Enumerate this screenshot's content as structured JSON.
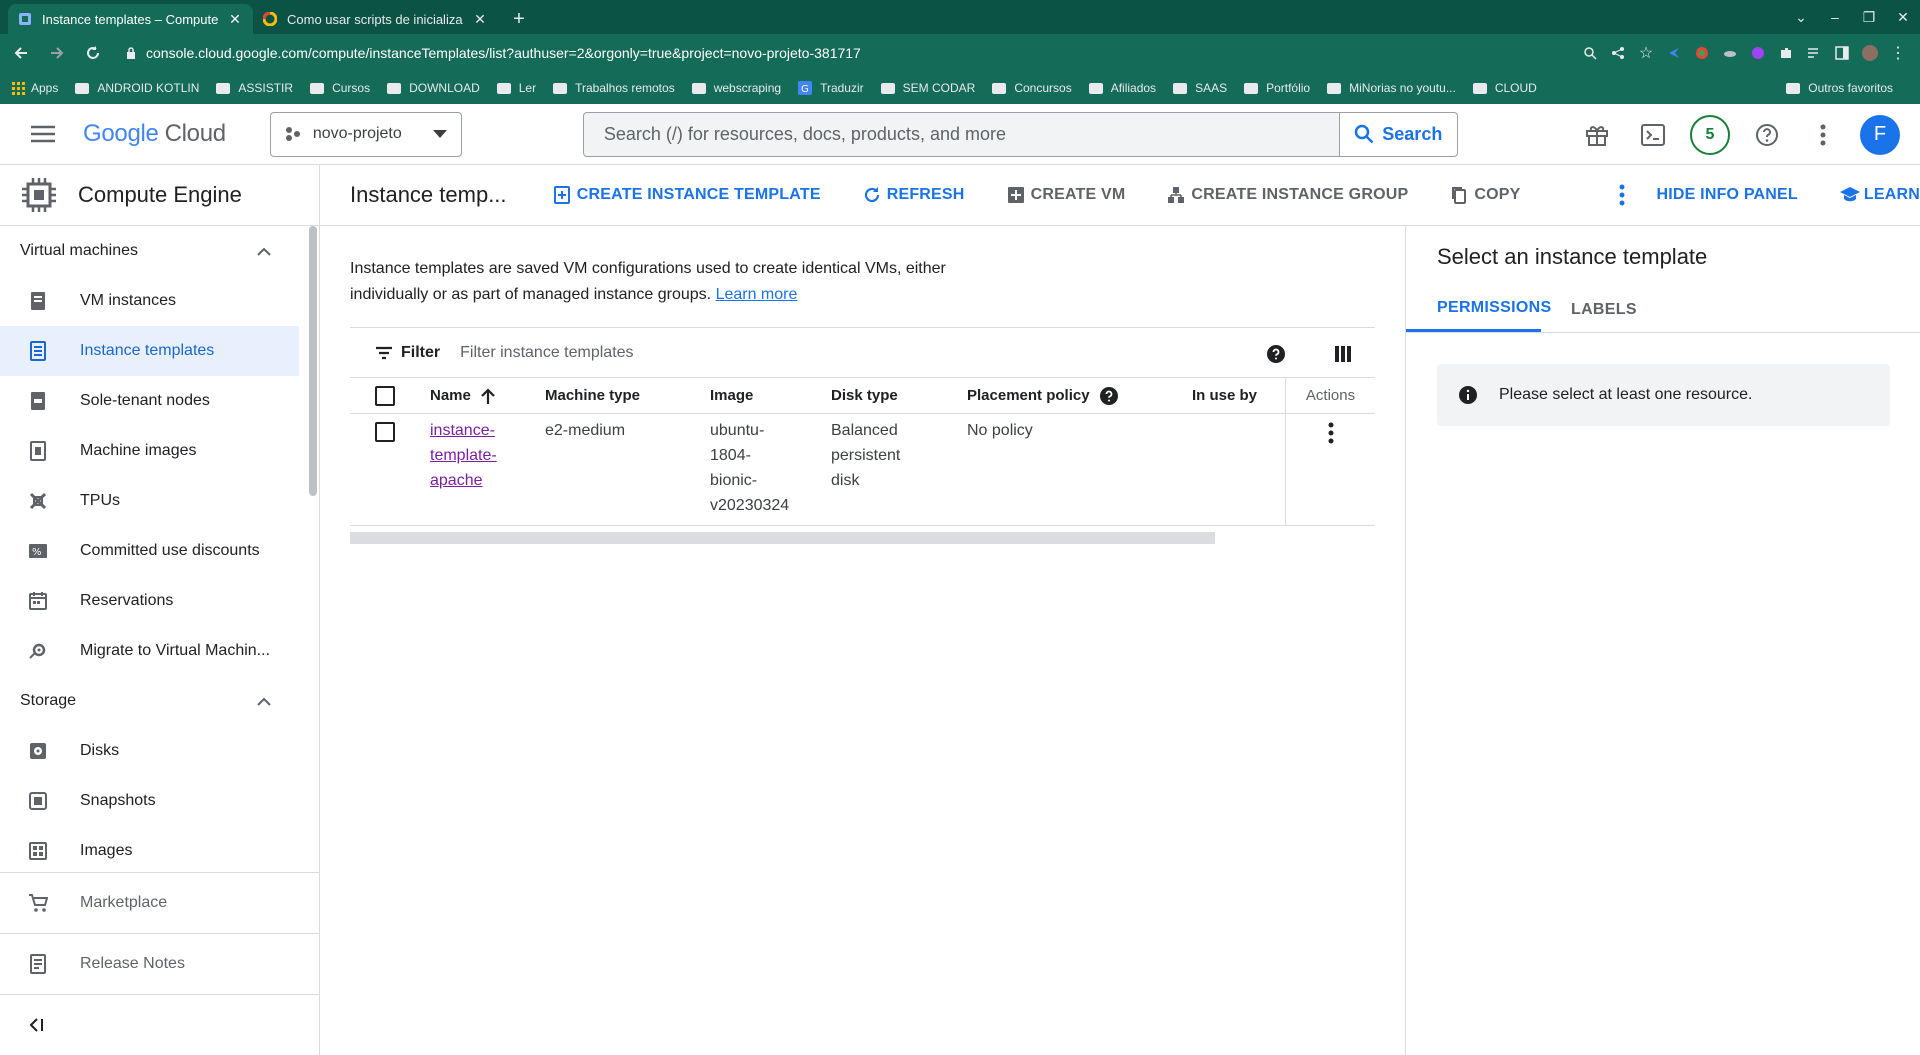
{
  "browser": {
    "tabs": [
      {
        "title": "Instance templates – Compute",
        "active": true
      },
      {
        "title": "Como usar scripts de inicializa",
        "active": false
      }
    ],
    "url": "console.cloud.google.com/compute/instanceTemplates/list?authuser=2&orgonly=true&project=novo-projeto-381717",
    "bookmarks": [
      "Apps",
      "ANDROID KOTLIN",
      "ASSISTIR",
      "Cursos",
      "DOWNLOAD",
      "Ler",
      "Trabalhos remotos",
      "webscraping",
      "Traduzir",
      "SEM CODAR",
      "Concursos",
      "Afiliados",
      "SAAS",
      "Portfólio",
      "MiNorias no youtu...",
      "CLOUD"
    ],
    "bookmarks_right": "Outros favoritos"
  },
  "header": {
    "logo_google": "Google",
    "logo_cloud": "Cloud",
    "project": "novo-projeto",
    "search_placeholder": "Search (/) for resources, docs, products, and more",
    "search_button": "Search",
    "notifications_count": "5",
    "avatar_letter": "F"
  },
  "sidebar": {
    "title": "Compute Engine",
    "sections": [
      {
        "label": "Virtual machines",
        "items": [
          "VM instances",
          "Instance templates",
          "Sole-tenant nodes",
          "Machine images",
          "TPUs",
          "Committed use discounts",
          "Reservations",
          "Migrate to Virtual Machin..."
        ]
      },
      {
        "label": "Storage",
        "items": [
          "Disks",
          "Snapshots",
          "Images"
        ]
      }
    ],
    "active_item": "Instance templates",
    "marketplace": "Marketplace",
    "release_notes": "Release Notes"
  },
  "toolbar": {
    "title": "Instance temp...",
    "create_template": "CREATE INSTANCE TEMPLATE",
    "refresh": "REFRESH",
    "create_vm": "CREATE VM",
    "create_group": "CREATE INSTANCE GROUP",
    "copy": "COPY",
    "hide_panel": "HIDE INFO PANEL",
    "learn": "LEARN"
  },
  "main": {
    "description": "Instance templates are saved VM configurations used to create identical VMs, either individually or as part of managed instance groups.",
    "learn_more": "Learn more",
    "filter_label": "Filter",
    "filter_placeholder": "Filter instance templates",
    "columns": [
      "Name",
      "Machine type",
      "Image",
      "Disk type",
      "Placement policy",
      "In use by",
      "Actions"
    ],
    "rows": [
      {
        "name": [
          "instance-",
          "template-",
          "apache"
        ],
        "machine_type": "e2-medium",
        "image": [
          "ubuntu-",
          "1804-",
          "bionic-",
          "v20230324"
        ],
        "disk_type": [
          "Balanced",
          "persistent",
          "disk"
        ],
        "placement_policy": "No policy",
        "in_use_by": ""
      }
    ]
  },
  "info_panel": {
    "title": "Select an instance template",
    "tabs": [
      "PERMISSIONS",
      "LABELS"
    ],
    "notice": "Please select at least one resource."
  },
  "colors": {
    "accent": "#1a73e8",
    "chrome": "#146b58",
    "link_visited": "#7b1fa2"
  }
}
